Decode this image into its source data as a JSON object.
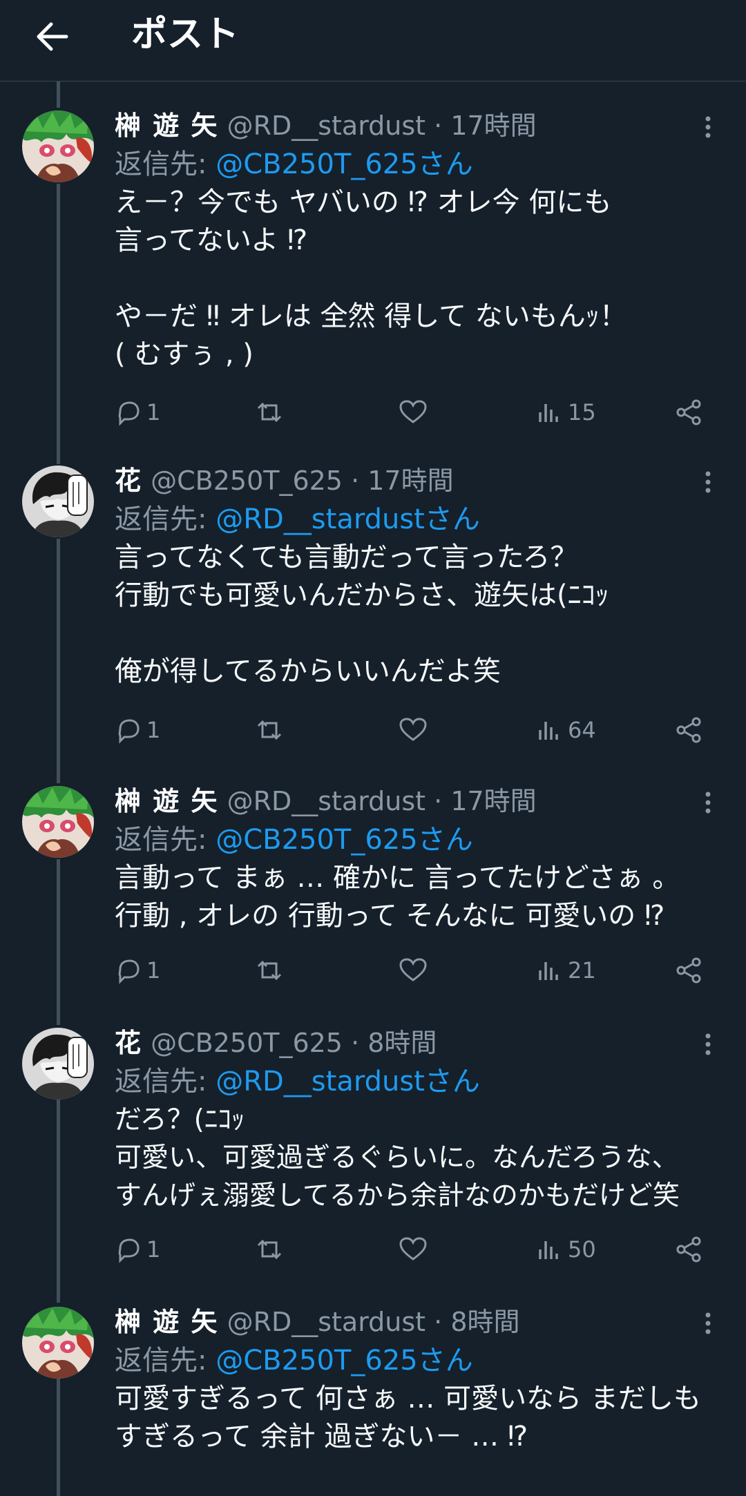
{
  "header": {
    "title": "ポスト"
  },
  "posts": [
    {
      "name": "榊 遊 矢",
      "handle": "@RD__stardust",
      "time": "17時間",
      "reply_prefix": "返信先:",
      "reply_to": "@CB250T_625さん",
      "text": "え－？今でも ヤバいの ⁉ オレ今 何にも\n言ってないよ ⁉\n\nや－だ ‼ オレは 全然 得して ないもんｯ！\n( むすぅ , )",
      "replies": "1",
      "views": "15",
      "avatar": "green-hair-avatar"
    },
    {
      "name": "花",
      "handle": "@CB250T_625",
      "time": "17時間",
      "reply_prefix": "返信先:",
      "reply_to": "@RD__stardustさん",
      "text": "言ってなくても言動だって言ったろ？\n行動でも可愛いんだからさ、遊矢は(ﾆｺｯ\n\n俺が得してるからいいんだよ笑",
      "replies": "1",
      "views": "64",
      "avatar": "dark-hair-avatar"
    },
    {
      "name": "榊 遊 矢",
      "handle": "@RD__stardust",
      "time": "17時間",
      "reply_prefix": "返信先:",
      "reply_to": "@CB250T_625さん",
      "text": "言動って まぁ … 確かに 言ってたけどさぁ 。\n行動 , オレの 行動って そんなに 可愛いの ⁉",
      "replies": "1",
      "views": "21",
      "avatar": "green-hair-avatar"
    },
    {
      "name": "花",
      "handle": "@CB250T_625",
      "time": "8時間",
      "reply_prefix": "返信先:",
      "reply_to": "@RD__stardustさん",
      "text": "だろ？(ﾆｺｯ\n可愛い、可愛過ぎるぐらいに。なんだろうな、\nすんげぇ溺愛してるから余計なのかもだけど笑",
      "replies": "1",
      "views": "50",
      "avatar": "dark-hair-avatar"
    },
    {
      "name": "榊 遊 矢",
      "handle": "@RD__stardust",
      "time": "8時間",
      "reply_prefix": "返信先:",
      "reply_to": "@CB250T_625さん",
      "text": "可愛すぎるって 何さぁ … 可愛いなら まだしも\nすぎるって 余計 過ぎない－ … ⁉",
      "avatar": "green-hair-avatar"
    }
  ],
  "colors": {
    "background": "#15202b",
    "link": "#1d9bf0",
    "muted": "#8b98a5",
    "thread": "#42505c"
  }
}
